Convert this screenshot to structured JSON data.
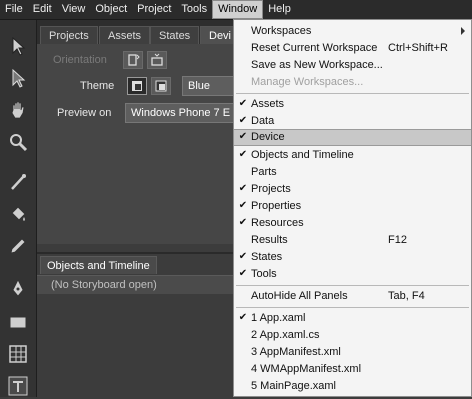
{
  "menubar": {
    "items": [
      "File",
      "Edit",
      "View",
      "Object",
      "Project",
      "Tools",
      "Window",
      "Help"
    ]
  },
  "tabs": [
    "Projects",
    "Assets",
    "States",
    "Devi"
  ],
  "device_panel": {
    "orientation_label": "Orientation",
    "theme_label": "Theme",
    "theme_color": "Blue",
    "preview_label": "Preview on",
    "preview_value": "Windows Phone 7 E"
  },
  "objects_panel": {
    "tab_label": "Objects and Timeline",
    "storyboard_text": "(No Storyboard open)"
  },
  "window_menu": {
    "items": [
      {
        "label": "Workspaces",
        "checked": false,
        "shortcut": "",
        "submenu": true
      },
      {
        "label": "Reset Current Workspace",
        "checked": false,
        "shortcut": "Ctrl+Shift+R"
      },
      {
        "label": "Save as New Workspace...",
        "checked": false,
        "shortcut": ""
      },
      {
        "label": "Manage Workspaces...",
        "checked": false,
        "shortcut": "",
        "disabled": true
      },
      {
        "label": "Assets",
        "checked": true,
        "shortcut": ""
      },
      {
        "label": "Data",
        "checked": true,
        "shortcut": ""
      },
      {
        "label": "Device",
        "checked": true,
        "shortcut": "",
        "highlighted": true
      },
      {
        "label": "Objects and Timeline",
        "checked": true,
        "shortcut": ""
      },
      {
        "label": "Parts",
        "checked": false,
        "shortcut": ""
      },
      {
        "label": "Projects",
        "checked": true,
        "shortcut": ""
      },
      {
        "label": "Properties",
        "checked": true,
        "shortcut": ""
      },
      {
        "label": "Resources",
        "checked": true,
        "shortcut": ""
      },
      {
        "label": "Results",
        "checked": false,
        "shortcut": "F12"
      },
      {
        "label": "States",
        "checked": true,
        "shortcut": ""
      },
      {
        "label": "Tools",
        "checked": true,
        "shortcut": ""
      },
      {
        "label": "AutoHide All Panels",
        "checked": false,
        "shortcut": "Tab, F4"
      },
      {
        "label": "1 App.xaml",
        "checked": true,
        "shortcut": ""
      },
      {
        "label": "2 App.xaml.cs",
        "checked": false,
        "shortcut": ""
      },
      {
        "label": "3 AppManifest.xml",
        "checked": false,
        "shortcut": ""
      },
      {
        "label": "4 WMAppManifest.xml",
        "checked": false,
        "shortcut": ""
      },
      {
        "label": "5 MainPage.xaml",
        "checked": false,
        "shortcut": ""
      }
    ],
    "check_glyph": "✔"
  }
}
